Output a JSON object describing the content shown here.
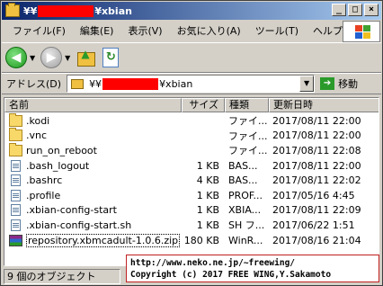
{
  "window": {
    "title_prefix": "¥¥",
    "title_suffix": "¥xbian",
    "minimize": "_",
    "maximize": "□",
    "close": "×"
  },
  "menu": [
    "ファイル(F)",
    "編集(E)",
    "表示(V)",
    "お気に入り(A)",
    "ツール(T)",
    "ヘルプ"
  ],
  "address": {
    "label": "アドレス(D)",
    "prefix": "¥¥",
    "suffix": "¥xbian",
    "go_label": "移動"
  },
  "columns": {
    "name": "名前",
    "size": "サイズ",
    "type": "種類",
    "date": "更新日時"
  },
  "files": [
    {
      "icon": "folder",
      "name": ".kodi",
      "size": "",
      "type": "ファイ...",
      "date": "2017/08/11 22:00"
    },
    {
      "icon": "folder",
      "name": ".vnc",
      "size": "",
      "type": "ファイ...",
      "date": "2017/08/11 22:00"
    },
    {
      "icon": "folder",
      "name": "run_on_reboot",
      "size": "",
      "type": "ファイ...",
      "date": "2017/08/11 22:08"
    },
    {
      "icon": "file",
      "name": ".bash_logout",
      "size": "1 KB",
      "type": "BAS...",
      "date": "2017/08/11 22:00"
    },
    {
      "icon": "file",
      "name": ".bashrc",
      "size": "4 KB",
      "type": "BAS...",
      "date": "2017/08/11 22:02"
    },
    {
      "icon": "file",
      "name": ".profile",
      "size": "1 KB",
      "type": "PROF...",
      "date": "2017/05/16 4:45"
    },
    {
      "icon": "file",
      "name": ".xbian-config-start",
      "size": "1 KB",
      "type": "XBIA...",
      "date": "2017/08/11 22:09"
    },
    {
      "icon": "file",
      "name": ".xbian-config-start.sh",
      "size": "1 KB",
      "type": "SH フ...",
      "date": "2017/06/22 1:51"
    },
    {
      "icon": "zip",
      "name": "repository.xbmcadult-1.0.6.zip",
      "size": "180 KB",
      "type": "WinR...",
      "date": "2017/08/16 21:04"
    }
  ],
  "status": {
    "text": "9 個のオブジェクト"
  },
  "copyright": {
    "line1": "http://www.neko.ne.jp/~freewing/",
    "line2": "Copyright (c) 2017 FREE WING,Y.Sakamoto"
  },
  "colors": {
    "titlebar_start": "#0a246a",
    "redaction": "#ff0000",
    "chrome": "#d4d0c8"
  }
}
